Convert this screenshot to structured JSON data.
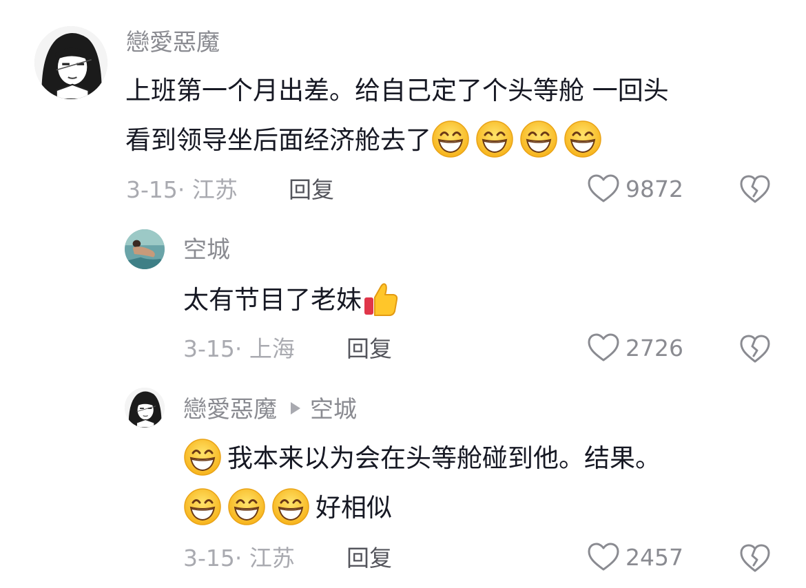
{
  "comments": [
    {
      "username": "戀愛惡魔",
      "text_line1": "上班第一个月出差。给自己定了个头等舱 一回头",
      "text_line2": "看到领导坐后面经济舱去了",
      "emoji_count": 4,
      "date_location": "3-15· 江苏",
      "reply_label": "回复",
      "likes": "9872"
    },
    {
      "username": "空城",
      "text": "太有节目了老妹",
      "date_location": "3-15· 上海",
      "reply_label": "回复",
      "likes": "2726"
    },
    {
      "username": "戀愛惡魔",
      "reply_to": "空城",
      "text_line1": "我本来以为会在头等舱碰到他。结果。",
      "text_line2": "好相似",
      "date_location": "3-15· 江苏",
      "reply_label": "回复",
      "likes": "2457"
    }
  ],
  "colors": {
    "text": "#161823",
    "secondary": "#8a8b91",
    "muted": "#a9aab0",
    "emoji_face": "#ffcc33"
  },
  "icons": [
    "heart-icon",
    "dislike-icon",
    "grin-emoji",
    "thumbs-up-emoji"
  ]
}
